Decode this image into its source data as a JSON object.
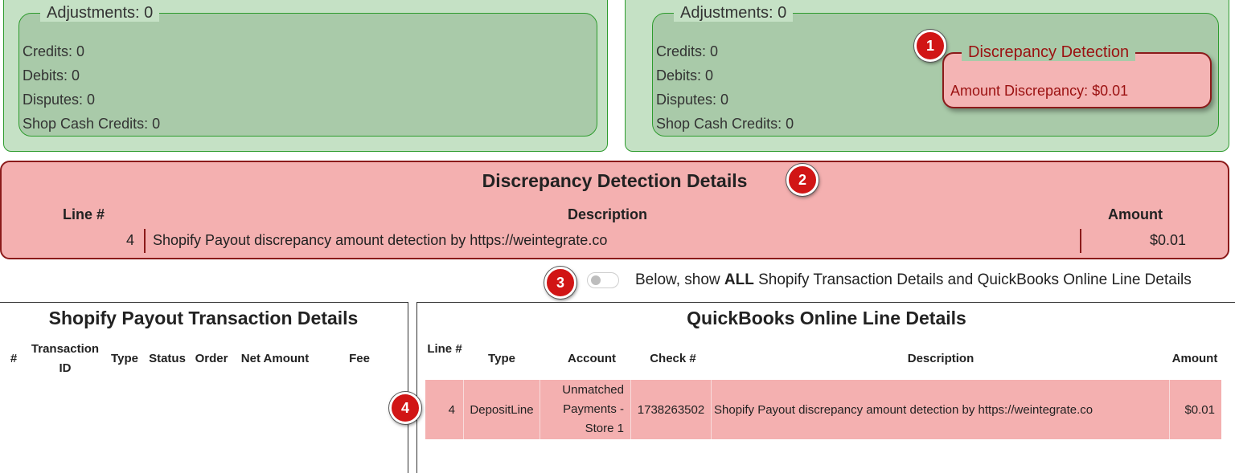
{
  "left_adjustments": {
    "legend": "Adjustments: 0",
    "items": [
      "Credits: 0",
      "Debits: 0",
      "Disputes: 0",
      "Shop Cash Credits: 0"
    ]
  },
  "right_adjustments": {
    "legend": "Adjustments: 0",
    "items": [
      "Credits: 0",
      "Debits: 0",
      "Disputes: 0",
      "Shop Cash Credits: 0"
    ]
  },
  "discrepancy_mini": {
    "legend": "Discrepancy Detection",
    "text": "Amount Discrepancy: $0.01"
  },
  "badges": [
    "1",
    "2",
    "3",
    "4"
  ],
  "discrepancy_details": {
    "title": "Discrepancy Detection Details",
    "headers": {
      "line": "Line #",
      "description": "Description",
      "amount": "Amount"
    },
    "row": {
      "line": "4",
      "description": "Shopify Payout discrepancy amount detection by https://weintegrate.co",
      "amount": "$0.01"
    }
  },
  "toggle": {
    "label_prefix": "Below, show ",
    "label_bold": "ALL",
    "label_suffix": " Shopify Transaction Details and QuickBooks Online Line Details",
    "checked": false
  },
  "shopify_panel": {
    "title": "Shopify Payout Transaction Details",
    "headers": [
      "#",
      "Transaction ID",
      "Type",
      "Status",
      "Order",
      "Net Amount",
      "Fee"
    ]
  },
  "qbo_panel": {
    "title": "QuickBooks Online Line Details",
    "headers": [
      "Line #",
      "Type",
      "Account",
      "Check #",
      "Description",
      "Amount"
    ],
    "row": {
      "line": "4",
      "type": "DepositLine",
      "account": "Unmatched Payments - Store 1",
      "check": "1738263502",
      "description": "Shopify Payout discrepancy amount detection by https://weintegrate.co",
      "amount": "$0.01"
    }
  },
  "colors": {
    "panel_green": "#c5e1c5",
    "fieldset_green": "#a9caa9",
    "border_green": "#2e9b2e",
    "discrepancy_pink": "#f4b0b0",
    "discrepancy_border": "#8b1a1a",
    "discrepancy_text": "#9b1111",
    "badge_red": "#d11515"
  }
}
